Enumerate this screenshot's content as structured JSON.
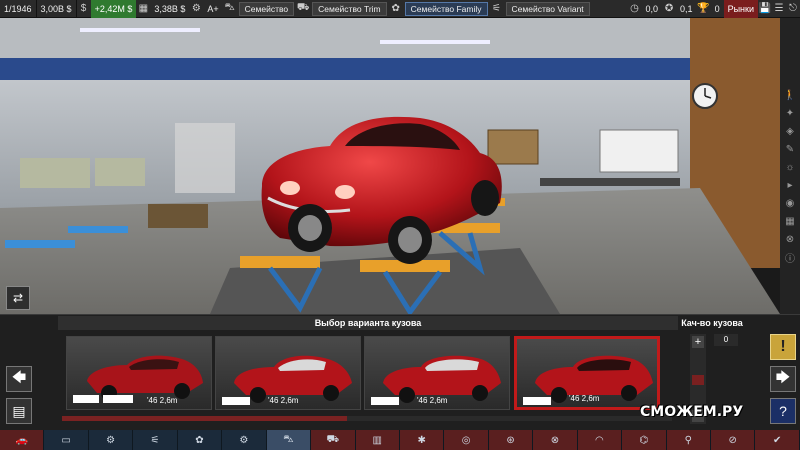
{
  "topbar": {
    "year": "1/1946",
    "cash": "3,00B $",
    "income": "+2,42M $",
    "loan": "3,38B $",
    "rating": "A+",
    "tabs": [
      {
        "label": "Семейство",
        "active": false
      },
      {
        "label": "Семейство Trim",
        "active": false
      },
      {
        "label": "Семейство Family",
        "active": true
      },
      {
        "label": "Семейство Variant",
        "active": false
      }
    ],
    "stat1": "0,0",
    "stat2": "0,1",
    "stat3": "0",
    "markets_label": "Рынки"
  },
  "panel": {
    "title": "Выбор варианта кузова",
    "quality_title": "Кач-во кузова",
    "quality_value": "0",
    "quality_level": 0.45,
    "warn_label": "!",
    "help_label": "?",
    "variants": [
      {
        "label": "'46 2,6m",
        "selected": false
      },
      {
        "label": "'46 2,6m",
        "selected": false
      },
      {
        "label": "'46 2,6m",
        "selected": false
      },
      {
        "label": "'46 2,6m",
        "selected": true
      }
    ]
  },
  "watermark": "СМОЖЕМ.РУ",
  "colors": {
    "accent_red": "#c11a1a",
    "topbar_bg": "#2a2a2a",
    "bottombar_bg": "#1b2a3a",
    "car_red": "#b3141a"
  }
}
